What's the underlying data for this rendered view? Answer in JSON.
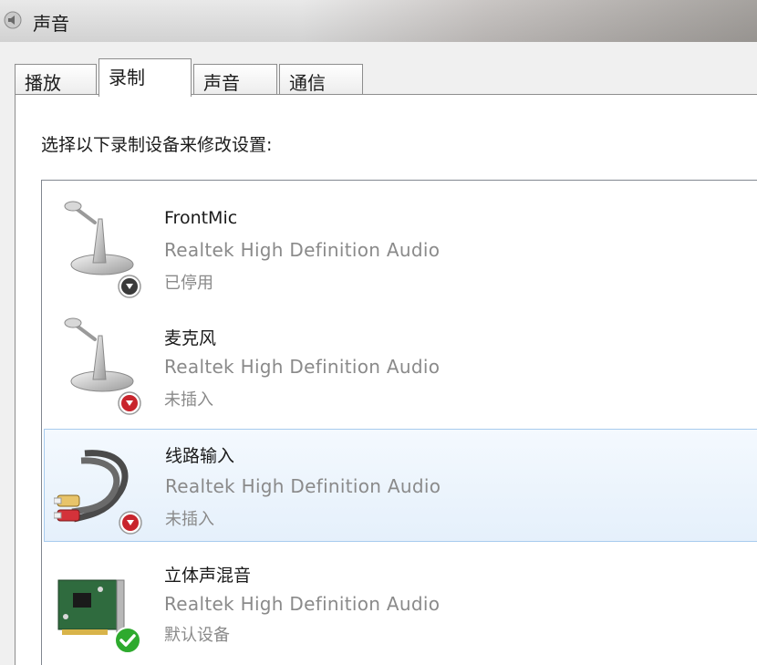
{
  "window": {
    "title": "声音"
  },
  "tabs": [
    {
      "label": "播放",
      "active": false
    },
    {
      "label": "录制",
      "active": true
    },
    {
      "label": "声音",
      "active": false
    },
    {
      "label": "通信",
      "active": false
    }
  ],
  "instruction": "选择以下录制设备来修改设置:",
  "devices": [
    {
      "name": "FrontMic",
      "driver": "Realtek High Definition Audio",
      "status": "已停用",
      "icon": "microphone-icon",
      "badge": "disabled-badge-icon",
      "selected": false
    },
    {
      "name": "麦克风",
      "driver": "Realtek High Definition Audio",
      "status": "未插入",
      "icon": "microphone-icon",
      "badge": "unplugged-badge-icon",
      "selected": false
    },
    {
      "name": "线路输入",
      "driver": "Realtek High Definition Audio",
      "status": "未插入",
      "icon": "line-in-cable-icon",
      "badge": "unplugged-badge-icon",
      "selected": true
    },
    {
      "name": "立体声混音",
      "driver": "Realtek High Definition Audio",
      "status": "默认设备",
      "icon": "sound-card-icon",
      "badge": "default-check-icon",
      "selected": false
    }
  ],
  "colors": {
    "selection_fill": "#e5f0fb",
    "selection_border": "#a7cbee",
    "secondary_text": "#8a8a8a",
    "default_check": "#2eaa2e"
  }
}
